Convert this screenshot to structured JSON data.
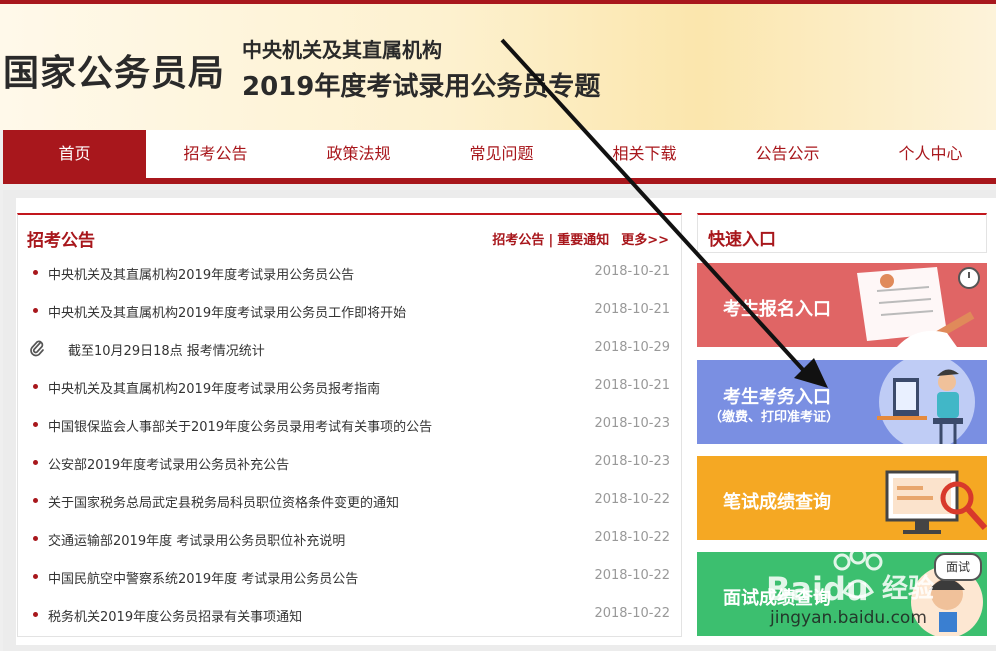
{
  "header": {
    "logo": "国家公务员局",
    "subtitle1": "中央机关及其直属机构",
    "subtitle2": "2019年度考试录用公务员专题"
  },
  "nav": {
    "items": [
      {
        "label": "首页",
        "active": true
      },
      {
        "label": "招考公告",
        "active": false
      },
      {
        "label": "政策法规",
        "active": false
      },
      {
        "label": "常见问题",
        "active": false
      },
      {
        "label": "相关下载",
        "active": false
      },
      {
        "label": "公告公示",
        "active": false
      },
      {
        "label": "个人中心",
        "active": false
      }
    ]
  },
  "announcements": {
    "title": "招考公告",
    "link1": "招考公告",
    "sep": "|",
    "link2": "重要通知",
    "more": "更多>>",
    "items": [
      {
        "title": "中央机关及其直属机构2019年度考试录用公务员公告",
        "date": "2018-10-21",
        "icon": "dot"
      },
      {
        "title": "中央机关及其直属机构2019年度考试录用公务员工作即将开始",
        "date": "2018-10-21",
        "icon": "dot"
      },
      {
        "title": "截至10月29日18点 报考情况统计",
        "date": "2018-10-29",
        "icon": "paperclip-icon"
      },
      {
        "title": "中央机关及其直属机构2019年度考试录用公务员报考指南",
        "date": "2018-10-21",
        "icon": "dot"
      },
      {
        "title": "中国银保监会人事部关于2019年度公务员录用考试有关事项的公告",
        "date": "2018-10-23",
        "icon": "dot"
      },
      {
        "title": "公安部2019年度考试录用公务员补充公告",
        "date": "2018-10-23",
        "icon": "dot"
      },
      {
        "title": "关于国家税务总局武定县税务局科员职位资格条件变更的通知",
        "date": "2018-10-22",
        "icon": "dot"
      },
      {
        "title": "交通运输部2019年度 考试录用公务员职位补充说明",
        "date": "2018-10-22",
        "icon": "dot"
      },
      {
        "title": "中国民航空中警察系统2019年度 考试录用公务员公告",
        "date": "2018-10-22",
        "icon": "dot"
      },
      {
        "title": "税务机关2019年度公务员招录有关事项通知",
        "date": "2018-10-22",
        "icon": "dot"
      }
    ]
  },
  "quick": {
    "title": "快速入口",
    "entries": [
      {
        "label": "考生报名入口",
        "sub": "",
        "color": "#e06565"
      },
      {
        "label": "考生考务入口",
        "sub": "（缴费、打印准考证）",
        "color": "#7a8fe2"
      },
      {
        "label": "笔试成绩查询",
        "sub": "",
        "color": "#f5a823"
      },
      {
        "label": "面试成绩查询",
        "sub": "",
        "color": "#3cbf6f"
      }
    ],
    "badge": "面试"
  },
  "watermark": {
    "brand": "Baidu",
    "brand_cn": "经验",
    "url": "jingyan.baidu.com"
  },
  "colors": {
    "brand_red": "#a8171c",
    "nav_active_bg": "#a8171c"
  }
}
